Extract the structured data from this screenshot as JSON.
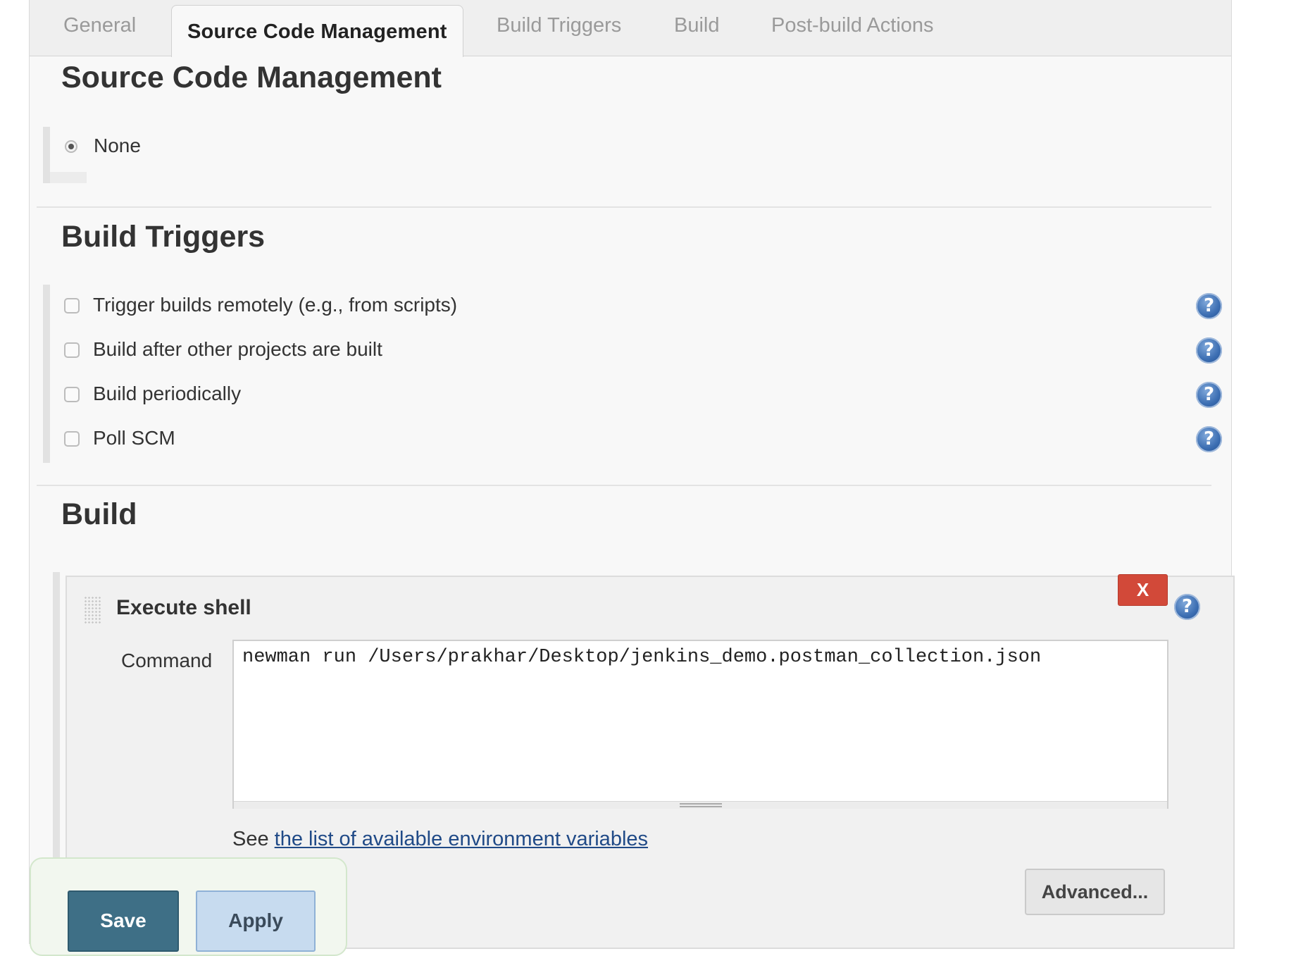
{
  "tabs": [
    {
      "label": "General",
      "active": false
    },
    {
      "label": "Source Code Management",
      "active": true
    },
    {
      "label": "Build Triggers",
      "active": false
    },
    {
      "label": "Build",
      "active": false
    },
    {
      "label": "Post-build Actions",
      "active": false
    }
  ],
  "scm": {
    "title": "Source Code Management",
    "options": [
      {
        "label": "None",
        "selected": true
      }
    ]
  },
  "triggers": {
    "title": "Build Triggers",
    "options": [
      {
        "label": "Trigger builds remotely (e.g., from scripts)",
        "checked": false,
        "icon": "help-icon"
      },
      {
        "label": "Build after other projects are built",
        "checked": false,
        "icon": "help-icon"
      },
      {
        "label": "Build periodically",
        "checked": false,
        "icon": "help-icon"
      },
      {
        "label": "Poll SCM",
        "checked": false,
        "icon": "help-icon"
      }
    ]
  },
  "build": {
    "title": "Build",
    "step": {
      "title": "Execute shell",
      "delete_label": "X",
      "command_label": "Command",
      "command_value": "newman run /Users/prakhar/Desktop/jenkins_demo.postman_collection.json",
      "env_prefix": "See ",
      "env_link": "the list of available environment variables",
      "advanced_label": "Advanced..."
    }
  },
  "actions": {
    "save_label": "Save",
    "apply_label": "Apply"
  },
  "colors": {
    "delete_button": "#d24939",
    "save_button": "#3e6f86",
    "apply_button": "#c7dbef",
    "help_icon": "#3d6fb3",
    "link": "#204a87"
  }
}
